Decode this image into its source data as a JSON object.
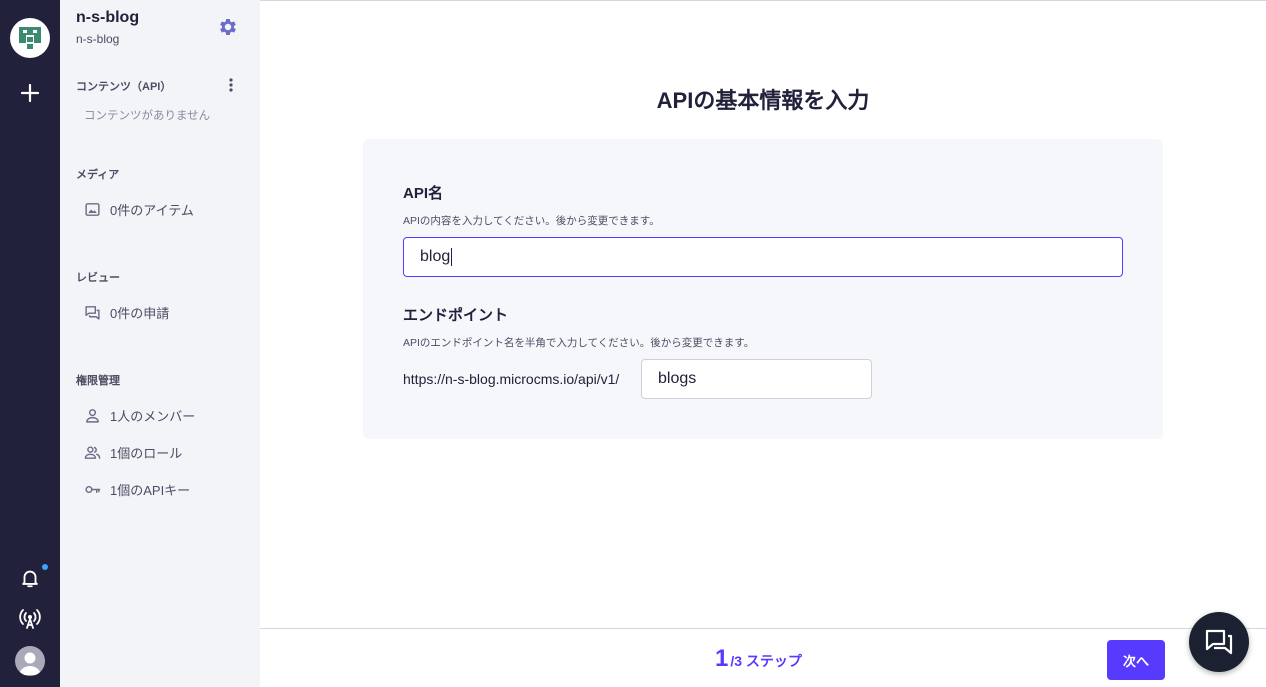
{
  "service": {
    "name": "n-s-blog",
    "id": "n-s-blog"
  },
  "sidebar": {
    "content_section": {
      "title": "コンテンツ（API）",
      "empty": "コンテンツがありません"
    },
    "media_section": {
      "title": "メディア",
      "item": "0件のアイテム"
    },
    "review_section": {
      "title": "レビュー",
      "item": "0件の申請"
    },
    "permission_section": {
      "title": "権限管理",
      "items": [
        "1人のメンバー",
        "1個のロール",
        "1個のAPIキー"
      ]
    }
  },
  "main": {
    "title": "APIの基本情報を入力",
    "api_name": {
      "label": "API名",
      "help": "APIの内容を入力してください。後から変更できます。",
      "value": "blog"
    },
    "endpoint": {
      "label": "エンドポイント",
      "help": "APIのエンドポイント名を半角で入力してください。後から変更できます。",
      "prefix": "https://n-s-blog.microcms.io/api/v1/",
      "value": "blogs"
    }
  },
  "footer": {
    "current_step": "1",
    "total_steps": "/3 ステップ",
    "next_label": "次へ"
  },
  "colors": {
    "accent": "#563bff",
    "rail": "#21213b",
    "sidebar": "#f3f4f8",
    "notification_dot": "#3ea3ff"
  },
  "icons": [
    "logo-icon",
    "plus-icon",
    "bell-icon",
    "antenna-icon",
    "avatar-icon",
    "gear-icon",
    "kebab-icon",
    "image-icon",
    "review-icon",
    "person-icon",
    "people-icon",
    "key-icon",
    "chat-icon"
  ]
}
